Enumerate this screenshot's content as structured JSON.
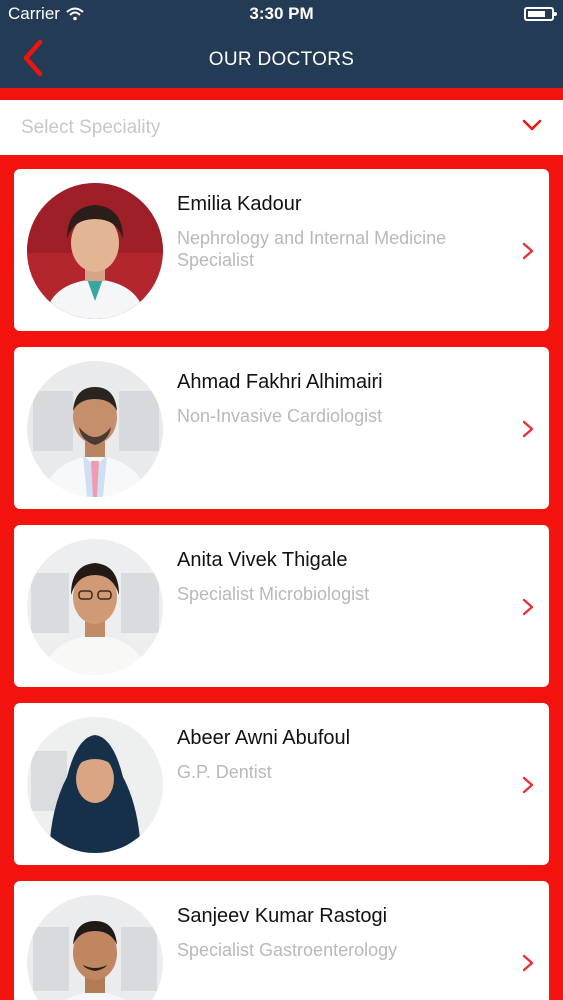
{
  "status_bar": {
    "carrier": "Carrier",
    "time": "3:30 PM"
  },
  "nav": {
    "title": "OUR DOCTORS",
    "back_icon": "chevron-left-icon",
    "accent_color": "#f2130e",
    "bar_color": "#243b55"
  },
  "filter": {
    "placeholder": "Select Speciality",
    "icon": "chevron-down-icon"
  },
  "doctors": [
    {
      "name": "Emilia Kadour",
      "specialty": "Nephrology and Internal Medicine Specialist"
    },
    {
      "name": "Ahmad Fakhri Alhimairi",
      "specialty": "Non-Invasive Cardiologist"
    },
    {
      "name": "Anita Vivek Thigale",
      "specialty": "Specialist Microbiologist"
    },
    {
      "name": "Abeer Awni Abufoul",
      "specialty": "G.P. Dentist"
    },
    {
      "name": "Sanjeev Kumar Rastogi",
      "specialty": "Specialist Gastroenterology"
    }
  ]
}
